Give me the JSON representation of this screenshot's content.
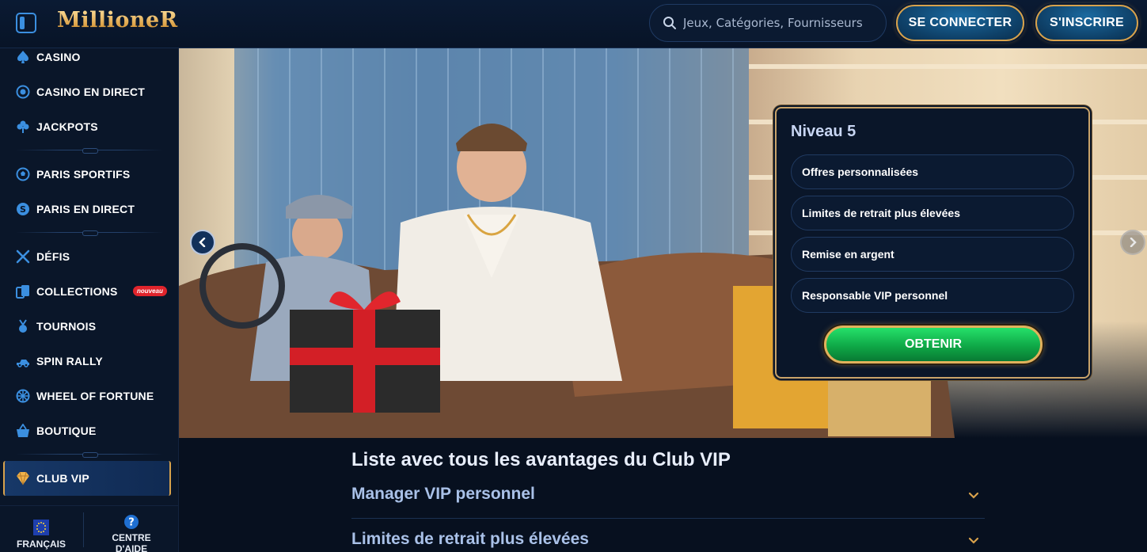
{
  "header": {
    "logo_text": "MillioneR",
    "search_placeholder": "Jeux, Catégories, Fournisseurs",
    "login_label": "SE CONNECTER",
    "register_label": "S'INSCRIRE"
  },
  "sidebar": {
    "items": [
      {
        "label": "CASINO",
        "icon": "spade-icon"
      },
      {
        "label": "CASINO EN DIRECT",
        "icon": "chip-icon"
      },
      {
        "label": "JACKPOTS",
        "icon": "clover-icon"
      },
      {
        "label": "PARIS SPORTIFS",
        "icon": "soccer-ball-icon"
      },
      {
        "label": "PARIS EN DIRECT",
        "icon": "coin-icon"
      },
      {
        "label": "DÉFIS",
        "icon": "crossed-swords-icon"
      },
      {
        "label": "COLLECTIONS",
        "icon": "cards-icon"
      },
      {
        "label": "TOURNOIS",
        "icon": "medal-icon"
      },
      {
        "label": "SPIN RALLY",
        "icon": "rally-icon"
      },
      {
        "label": "WHEEL OF FORTUNE",
        "icon": "wheel-icon"
      },
      {
        "label": "BOUTIQUE",
        "icon": "basket-icon"
      },
      {
        "label": "CLUB VIP",
        "icon": "diamond-icon"
      }
    ],
    "new_badge": "nouveau",
    "footer": {
      "language_label": "FRANÇAIS",
      "help_label_line1": "CENTRE",
      "help_label_line2": "D'AIDE"
    }
  },
  "vip_panel": {
    "title": "Niveau 5",
    "perks": [
      "Offres personnalisées",
      "Limites de retrait plus élevées",
      "Remise en argent",
      "Responsable VIP personnel"
    ],
    "cta_label": "OBTENIR"
  },
  "benefits": {
    "title": "Liste avec tous les avantages du Club VIP",
    "items": [
      "Manager VIP personnel",
      "Limites de retrait plus élevées"
    ]
  },
  "colors": {
    "accent_gold": "#d8a24c",
    "accent_blue": "#3b8fe0",
    "cta_green": "#0fa847",
    "badge_red": "#e0242c",
    "background": "#07101f"
  }
}
